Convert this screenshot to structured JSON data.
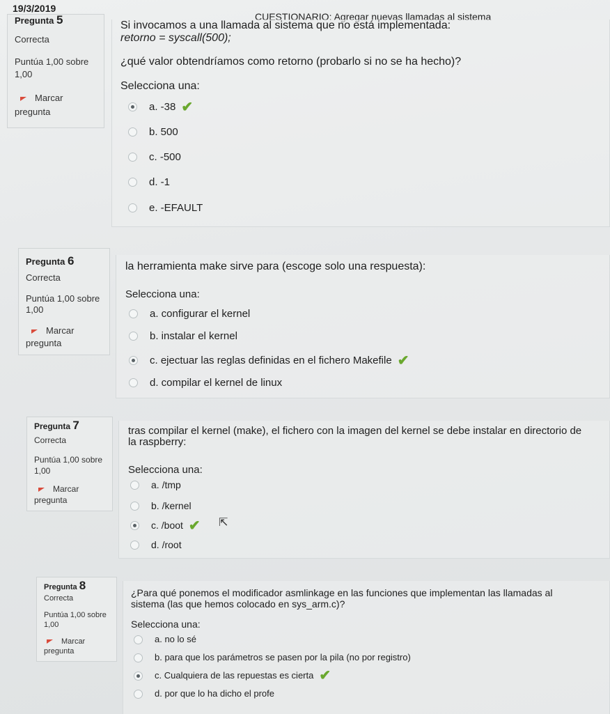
{
  "header": {
    "date": "19/3/2019",
    "title": "CUESTIONARIO: Agregar nuevas llamadas al sistema"
  },
  "questions": [
    {
      "label": "Pregunta",
      "number": "5",
      "status": "Correcta",
      "score_line1": "Puntúa 1,00 sobre",
      "score_line2": "1,00",
      "flag_line1": "Marcar",
      "flag_line2": "pregunta",
      "text_line1": "Si invocamos a una llamada al sistema que no está implementada:",
      "text_line2": "retorno = syscall(500);",
      "text_line3": "¿qué valor obtendríamos como retorno (probarlo si no se ha hecho)?",
      "select_label": "Selecciona una:",
      "options": [
        "a. -38",
        "b. 500",
        "c. -500",
        "d. -1",
        "e. -EFAULT"
      ]
    },
    {
      "label": "Pregunta",
      "number": "6",
      "status": "Correcta",
      "score_line1": "Puntúa 1,00 sobre",
      "score_line2": "1,00",
      "flag_line1": "Marcar",
      "flag_line2": "pregunta",
      "text_line1": "la herramienta make sirve para (escoge solo una respuesta):",
      "select_label": "Selecciona una:",
      "options": [
        "a. configurar el kernel",
        "b. instalar el kernel",
        "c. ejectuar las reglas definidas en el fichero Makefile",
        "d. compilar el kernel de linux"
      ]
    },
    {
      "label": "Pregunta",
      "number": "7",
      "status": "Correcta",
      "score_line1": "Puntúa 1,00 sobre",
      "score_line2": "1,00",
      "flag_line1": "Marcar",
      "flag_line2": "pregunta",
      "text_line1": "tras compilar el kernel (make), el fichero con la imagen del kernel se debe instalar en directorio de",
      "text_line2": "la raspberry:",
      "select_label": "Selecciona una:",
      "options": [
        "a. /tmp",
        "b. /kernel",
        "c. /boot",
        "d. /root"
      ]
    },
    {
      "label": "Pregunta",
      "number": "8",
      "status": "Correcta",
      "score_line1": "Puntúa 1,00 sobre",
      "score_line2": "1,00",
      "flag_line1": "Marcar",
      "flag_line2": "pregunta",
      "text_line1": "¿Para qué ponemos el modificador asmlinkage en las funciones que implementan las llamadas al",
      "text_line2": "sistema (las que hemos colocado en sys_arm.c)?",
      "select_label": "Selecciona una:",
      "options": [
        "a. no lo sé",
        "b. para que los parámetros se pasen por la pila (no por registro)",
        "c. Cualquiera de las repuestas es cierta",
        "d. por que lo ha dicho el profe"
      ]
    }
  ],
  "icons": {
    "correct": "checkmark-icon",
    "flag": "flag-icon",
    "cursor": "mouse-pointer-icon"
  },
  "colors": {
    "check": "#6aa82e",
    "flag": "#d94b3b"
  }
}
